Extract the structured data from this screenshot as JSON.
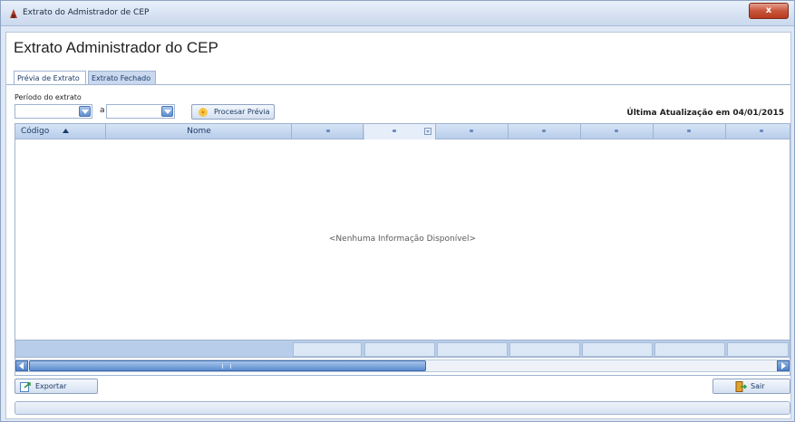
{
  "window": {
    "title": "Extrato do Admistrador de CEP",
    "close_label": "x"
  },
  "heading": "Extrato Administrador do CEP",
  "tabs": [
    {
      "label": "Prévia de Extrato",
      "active": true
    },
    {
      "label": "Extrato Fechado",
      "active": false
    }
  ],
  "filter": {
    "period_label": "Período do extrato",
    "date_from": "",
    "separator": "a",
    "date_to": "",
    "process_button": "Procesar Prévia"
  },
  "last_update": "Última Atualização em 04/01/2015",
  "grid": {
    "columns": [
      "Código",
      "Nome",
      "",
      "",
      "",
      "",
      "",
      "",
      ""
    ],
    "empty_message": "<Nenhuma Informação Disponível>"
  },
  "buttons": {
    "export": "Exportar",
    "exit": "Sair"
  },
  "colors": {
    "accent": "#5d8fcf",
    "header": "#b8cdea",
    "close": "#c8553a"
  }
}
